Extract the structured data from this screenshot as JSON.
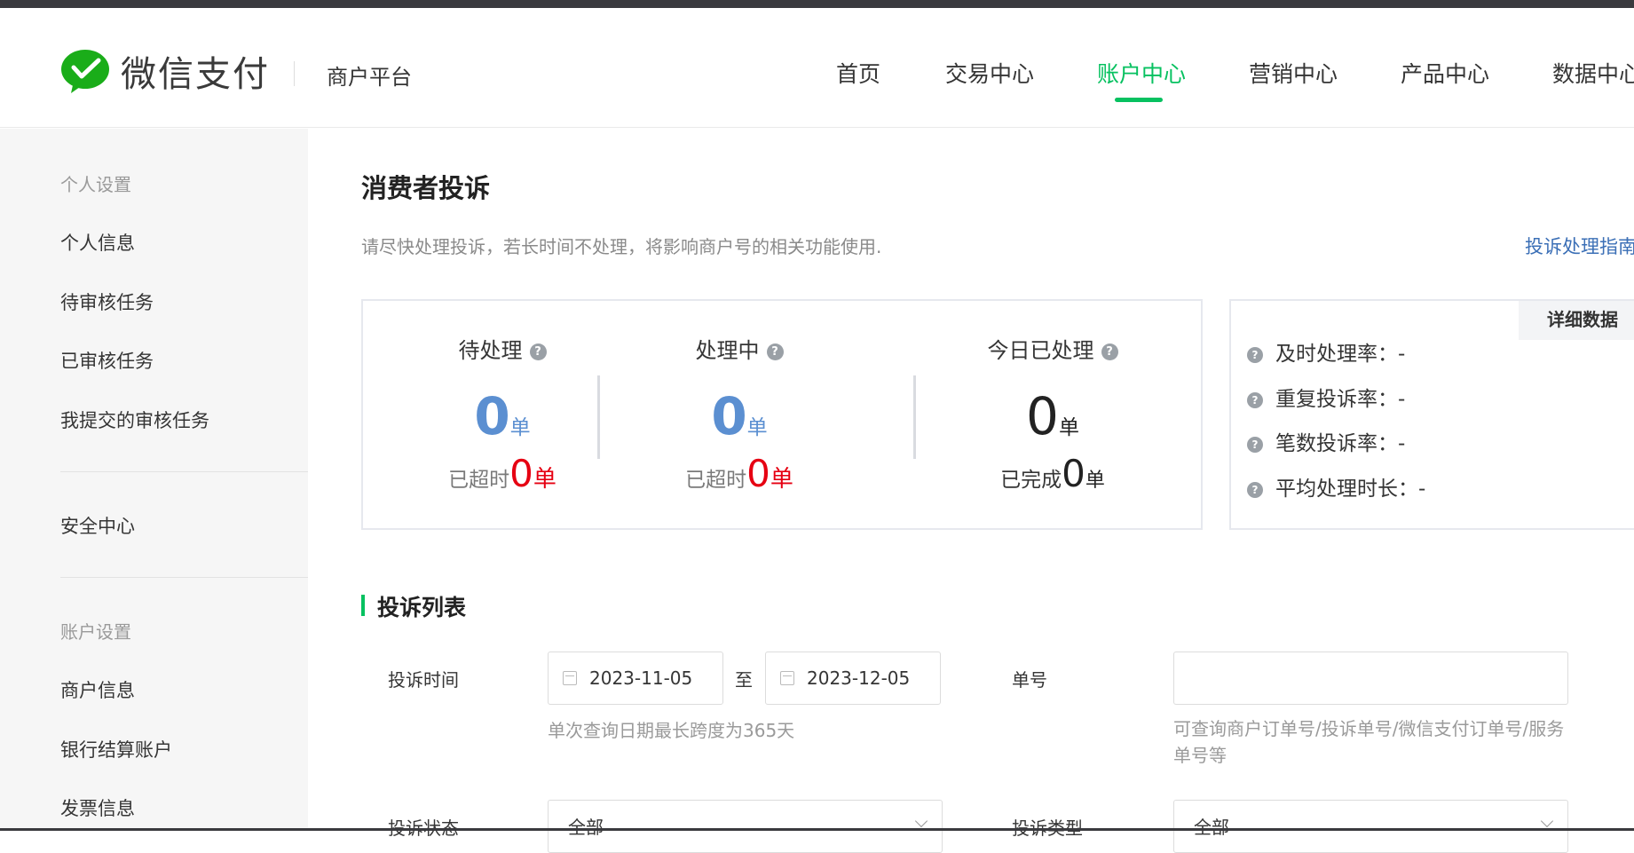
{
  "header": {
    "brand": "微信支付",
    "platform": "商户平台",
    "nav": [
      {
        "label": "首页",
        "active": false
      },
      {
        "label": "交易中心",
        "active": false
      },
      {
        "label": "账户中心",
        "active": true
      },
      {
        "label": "营销中心",
        "active": false
      },
      {
        "label": "产品中心",
        "active": false
      },
      {
        "label": "数据中心",
        "active": false
      }
    ],
    "accent": "#07c160"
  },
  "sidebar": {
    "groups": [
      {
        "title": "个人设置",
        "items": [
          "个人信息",
          "待审核任务",
          "已审核任务",
          "我提交的审核任务"
        ]
      },
      {
        "title": "",
        "items": [
          "安全中心"
        ]
      },
      {
        "title": "账户设置",
        "items": [
          "商户信息",
          "银行结算账户",
          "发票信息"
        ]
      }
    ]
  },
  "main": {
    "title": "消费者投诉",
    "notice": "请尽快处理投诉，若长时间不处理，将影响商户号的相关功能使用.",
    "guide_link": "投诉处理指南",
    "stats": [
      {
        "label": "待处理",
        "value": "0",
        "unit": "单",
        "sub_label": "已超时",
        "sub_value": "0",
        "sub_unit": "单"
      },
      {
        "label": "处理中",
        "value": "0",
        "unit": "单",
        "sub_label": "已超时",
        "sub_value": "0",
        "sub_unit": "单"
      },
      {
        "label": "今日已处理",
        "value": "0",
        "unit": "单",
        "sub_label": "已完成",
        "sub_value": "0",
        "sub_unit": "单"
      }
    ],
    "rates": {
      "tab": "详细数据",
      "items": [
        {
          "label": "及时处理率：",
          "value": "-"
        },
        {
          "label": "重复投诉率：",
          "value": "-"
        },
        {
          "label": "笔数投诉率：",
          "value": "-"
        },
        {
          "label": "平均处理时长：",
          "value": "-"
        }
      ]
    },
    "list": {
      "title": "投诉列表",
      "time_label": "投诉时间",
      "start_date": "2023-11-05",
      "to": "至",
      "end_date": "2023-12-05",
      "date_hint": "单次查询日期最长跨度为365天",
      "order_label": "单号",
      "order_hint": "可查询商户订单号/投诉单号/微信支付订单号/服务单号等",
      "status_label": "投诉状态",
      "status_value": "全部",
      "type_label": "投诉类型",
      "type_value": "全部"
    }
  }
}
